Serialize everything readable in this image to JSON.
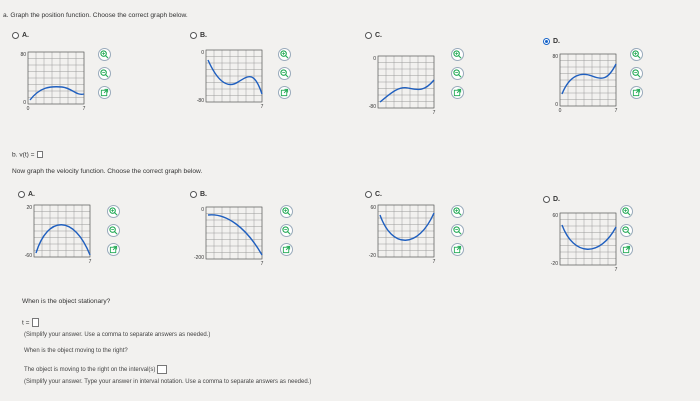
{
  "part_a": {
    "prompt": "a. Graph the position function. Choose the correct graph below.",
    "options": [
      {
        "label": "A.",
        "selected": false,
        "y_ticks": [
          "80",
          "0"
        ],
        "x_ticks": [
          "0",
          "7"
        ]
      },
      {
        "label": "B.",
        "selected": false,
        "y_ticks": [
          "0",
          "-80"
        ],
        "x_ticks": [
          "7"
        ]
      },
      {
        "label": "C.",
        "selected": false,
        "y_ticks": [
          "0",
          "-80"
        ],
        "x_ticks": [
          "7"
        ]
      },
      {
        "label": "D.",
        "selected": true,
        "y_ticks": [
          "80",
          "0"
        ],
        "x_ticks": [
          "0",
          "7"
        ]
      }
    ]
  },
  "part_b": {
    "label": "b. v(t) =",
    "prompt": "Now graph the velocity function. Choose the correct graph below.",
    "options": [
      {
        "label": "A.",
        "selected": false,
        "y_ticks": [
          "20",
          "-60"
        ],
        "x_ticks": [
          "7"
        ]
      },
      {
        "label": "B.",
        "selected": false,
        "y_ticks": [
          "0",
          "-200"
        ],
        "x_ticks": [
          "7"
        ]
      },
      {
        "label": "C.",
        "selected": false,
        "y_ticks": [
          "60",
          "-20"
        ],
        "x_ticks": [
          "7"
        ]
      },
      {
        "label": "D.",
        "selected": false,
        "y_ticks": [
          "60",
          "-20"
        ],
        "x_ticks": [
          "7"
        ]
      }
    ]
  },
  "part_c": {
    "question": "When is the object stationary?",
    "t_label": "t =",
    "hint1": "(Simplify your answer. Use a comma to separate answers as needed.)",
    "question2": "When is the object moving to the right?",
    "interval_text": "The object is moving to the right on the interval(s)",
    "hint2": "(Simplify your answer. Type your answer in interval notation. Use a comma to separate answers as needed.)"
  },
  "icons": [
    "zoom-in-icon",
    "zoom-out-icon",
    "external-link-icon"
  ],
  "colors": {
    "curve": "#1f5fbf",
    "grid": "#9a9a9a",
    "radio_selected": "#1a66c9"
  }
}
